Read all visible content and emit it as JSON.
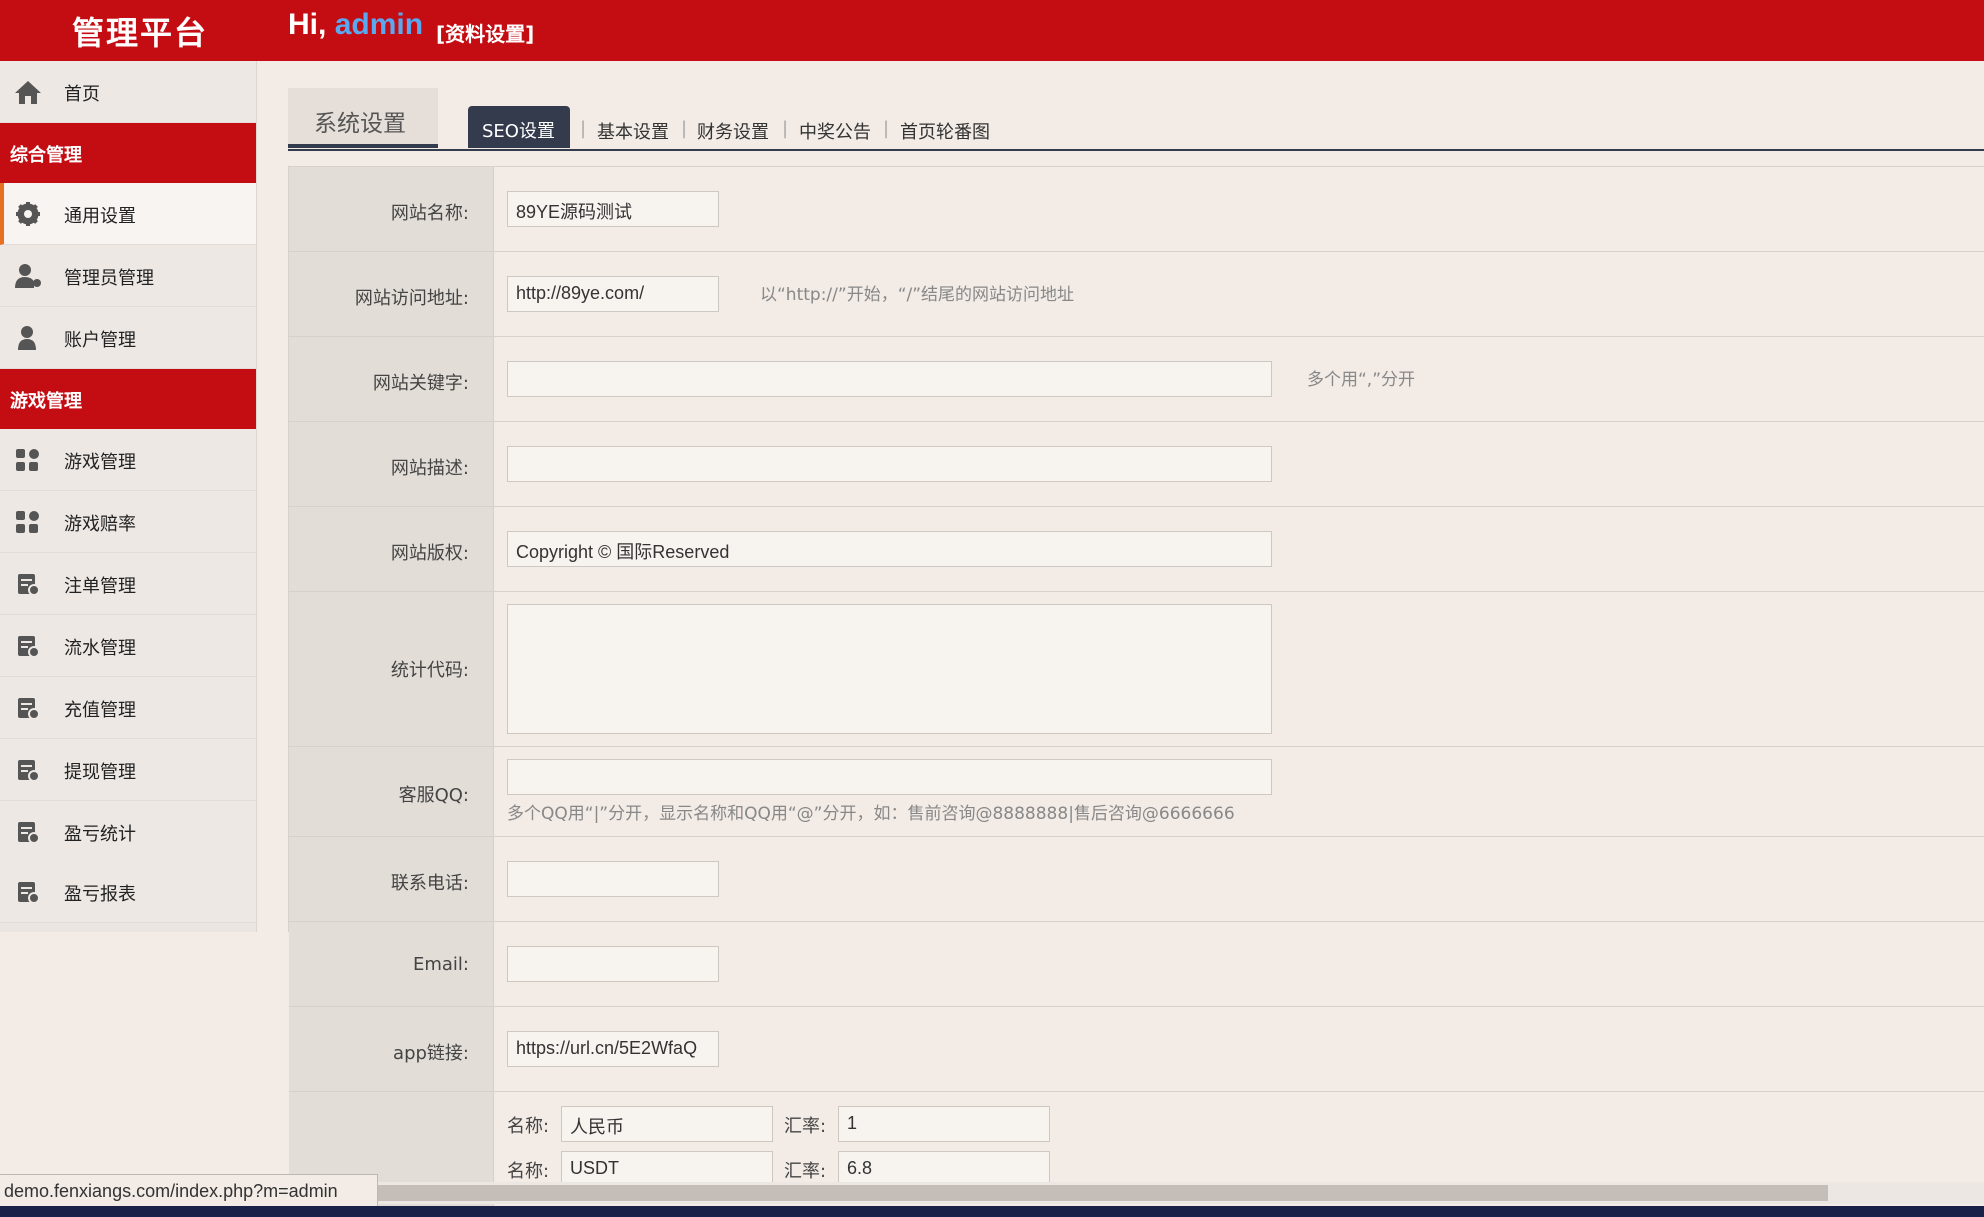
{
  "header": {
    "brand": "管理平台",
    "greeting": "Hi,",
    "username": "admin",
    "profile_link": "[资料设置]"
  },
  "sidebar": {
    "home": "首页",
    "group1": "综合管理",
    "general_settings": "通用设置",
    "admin_manage": "管理员管理",
    "account_manage": "账户管理",
    "group2": "游戏管理",
    "game_manage": "游戏管理",
    "game_odds": "游戏赔率",
    "bet_manage": "注单管理",
    "flow_manage": "流水管理",
    "recharge_manage": "充值管理",
    "withdraw_manage": "提现管理",
    "profit_stats": "盈亏统计",
    "profit_report": "盈亏报表"
  },
  "tabs": {
    "section_title": "系统设置",
    "seo": "SEO设置",
    "basic": "基本设置",
    "finance": "财务设置",
    "winning": "中奖公告",
    "carousel": "首页轮番图",
    "sep": "|"
  },
  "form": {
    "site_name_label": "网站名称:",
    "site_name_value": "89YE源码测试",
    "site_url_label": "网站访问地址:",
    "site_url_value": "http://89ye.com/",
    "site_url_hint": "以“http://”开始，“/”结尾的网站访问地址",
    "keywords_label": "网站关键字:",
    "keywords_value": "",
    "keywords_hint": "多个用“,”分开",
    "desc_label": "网站描述:",
    "desc_value": "",
    "copyright_label": "网站版权:",
    "copyright_value": "Copyright © 国际Reserved",
    "stats_label": "统计代码:",
    "stats_value": "",
    "qq_label": "客服QQ:",
    "qq_value": "",
    "qq_hint": "多个QQ用“|”分开，显示名称和QQ用“@”分开，如：售前咨询@8888888|售后咨询@6666666",
    "phone_label": "联系电话:",
    "phone_value": "",
    "email_label": "Email:",
    "email_value": "",
    "app_label": "app链接:",
    "app_value": "https://url.cn/5E2WfaQ",
    "currency_name_label": "名称:",
    "currency_rate_label": "汇率:",
    "currency1_name": "人民币",
    "currency1_rate": "1",
    "currency2_name": "USDT",
    "currency2_rate": "6.8"
  },
  "status_bar": {
    "url": "demo.fenxiangs.com/index.php?m=admin"
  },
  "colors": {
    "header": "#c40d13",
    "tab_active": "#333b4d",
    "active_marker": "#e77022"
  }
}
